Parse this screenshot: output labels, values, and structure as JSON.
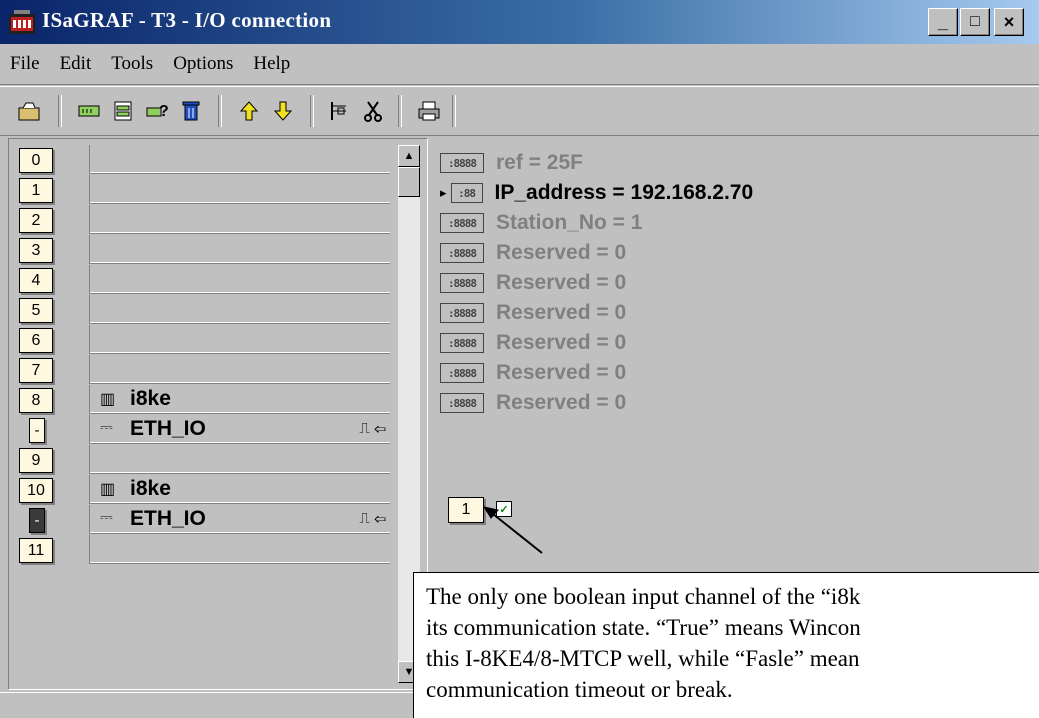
{
  "window": {
    "title": "ISaGRAF - T3 - I/O connection",
    "controls": {
      "minimize": "_",
      "maximize": "□",
      "close": "×"
    }
  },
  "menu": [
    "File",
    "Edit",
    "Tools",
    "Options",
    "Help"
  ],
  "toolbar": {
    "icons": [
      "open-icon",
      "board-icon",
      "library-icon",
      "help-icon",
      "delete-icon",
      "move-up-icon",
      "move-down-icon",
      "connect-icon",
      "cut-icon",
      "print-icon"
    ]
  },
  "slots": [
    {
      "num": "0",
      "label": "",
      "style": "normal"
    },
    {
      "num": "1",
      "label": "",
      "style": "normal"
    },
    {
      "num": "2",
      "label": "",
      "style": "normal"
    },
    {
      "num": "3",
      "label": "",
      "style": "normal"
    },
    {
      "num": "4",
      "label": "",
      "style": "normal"
    },
    {
      "num": "5",
      "label": "",
      "style": "normal"
    },
    {
      "num": "6",
      "label": "",
      "style": "normal"
    },
    {
      "num": "7",
      "label": "",
      "style": "normal"
    },
    {
      "num": "8",
      "label": "i8ke",
      "style": "normal",
      "icon": "board-icon"
    },
    {
      "num": "-",
      "label": "ETH_IO",
      "style": "dash",
      "icon": "card-icon",
      "sym": "⎍ ⇦"
    },
    {
      "num": "9",
      "label": "",
      "style": "normal"
    },
    {
      "num": "10",
      "label": "i8ke",
      "style": "normal",
      "icon": "board-icon"
    },
    {
      "num": "-",
      "label": "ETH_IO",
      "style": "dark",
      "icon": "card-icon",
      "sym": "⎍ ⇦"
    },
    {
      "num": "11",
      "label": "",
      "style": "normal"
    }
  ],
  "params": [
    {
      "box": ":8888",
      "text": "ref = 25F",
      "selected": false
    },
    {
      "box": ":88",
      "text": "IP_address = 192.168.2.70",
      "selected": true
    },
    {
      "box": ":8888",
      "text": "Station_No = 1",
      "selected": false
    },
    {
      "box": ":8888",
      "text": "Reserved = 0",
      "selected": false
    },
    {
      "box": ":8888",
      "text": "Reserved = 0",
      "selected": false
    },
    {
      "box": ":8888",
      "text": "Reserved = 0",
      "selected": false
    },
    {
      "box": ":8888",
      "text": "Reserved = 0",
      "selected": false
    },
    {
      "box": ":8888",
      "text": "Reserved = 0",
      "selected": false
    },
    {
      "box": ":8888",
      "text": "Reserved = 0",
      "selected": false
    }
  ],
  "channel": {
    "num": "1"
  },
  "callout": {
    "text": "The only one boolean input channel of the “i8k\nits communication state. “True” means Wincon\nthis I-8KE4/8-MTCP well, while “Fasle” mean\ncommunication timeout or break."
  }
}
